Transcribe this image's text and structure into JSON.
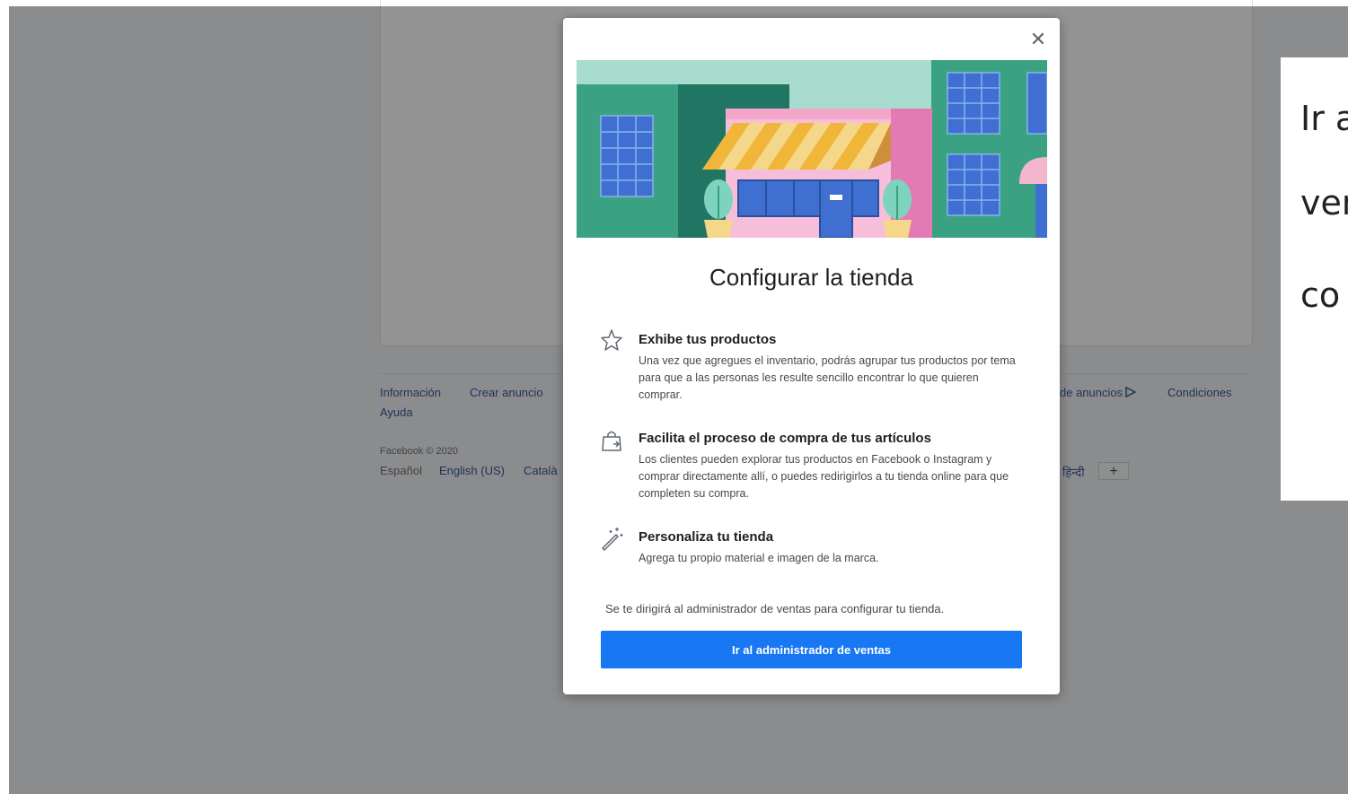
{
  "footer": {
    "links_row1": [
      "Información",
      "Crear anuncio"
    ],
    "links_row1_right": [
      "de anuncios",
      "Condiciones"
    ],
    "link_help": "Ayuda",
    "copyright": "Facebook © 2020",
    "languages": [
      "Español",
      "English (US)",
      "Català"
    ],
    "language_right": "हिन्दी",
    "more_languages": "+"
  },
  "side_panel": {
    "lines": [
      "Ir a",
      "ven",
      "co"
    ]
  },
  "modal": {
    "close_icon": "close-icon",
    "title": "Configurar la tienda",
    "features": [
      {
        "icon": "star-icon",
        "title": "Exhibe tus productos",
        "desc": "Una vez que agregues el inventario, podrás agrupar tus productos por tema para que a las personas les resulte sencillo encontrar lo que quieren comprar."
      },
      {
        "icon": "shopping-bag-icon",
        "title": "Facilita el proceso de compra de tus artículos",
        "desc": "Los clientes pueden explorar tus productos en Facebook o Instagram y comprar directamente allí, o puedes redirigirlos a tu tienda online para que completen su compra."
      },
      {
        "icon": "magic-wand-icon",
        "title": "Personaliza tu tienda",
        "desc": "Agrega tu propio material e imagen de la marca."
      }
    ],
    "redirect_note": "Se te dirigirá al administrador de ventas para configurar tu tienda.",
    "primary_button": "Ir al administrador de ventas"
  },
  "colors": {
    "primary": "#1877f2",
    "overlay": "rgba(0,0,0,0.42)",
    "link": "#385898"
  }
}
